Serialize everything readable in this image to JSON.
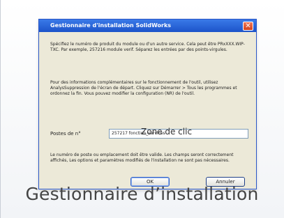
{
  "window": {
    "title": "Gestionnaire d'installation SolidWorks",
    "close_glyph": "✕"
  },
  "paragraphs": {
    "p1": "Spécifiez le numéro de produit du module ou d'un autre service. Cela peut être PRxXXX.WIP-TXC. Par exemple, 257216 module verif. Séparez les entrées par des points-virgules.",
    "p2": "Pour des informations complémentaires sur le fonctionnement de l'outil, utilisez AnalysSuppression de l'écran de départ. Cliquez sur Démarrer > Tous les programmes et ordonnez la fin. Vous pouvez modifier la configuration (NR) de l'outil.",
    "p3": "Le numéro de poste ou emplacement doit être valide. Les champs seront correctement affichés, Les options et paramètres modifiés de l'installation ne sont pas nécessaires."
  },
  "field": {
    "label": "Postes de n°",
    "value": "257217 fonction_services"
  },
  "overlay": {
    "zone_label": "Zone de clic"
  },
  "buttons": {
    "ok": "OK",
    "cancel": "Annuler"
  },
  "caption": "Gestionnaire d’installation",
  "colors": {
    "titlebar": "#2359d3",
    "close": "#d94b28",
    "dialog_bg": "#ece9d8"
  }
}
